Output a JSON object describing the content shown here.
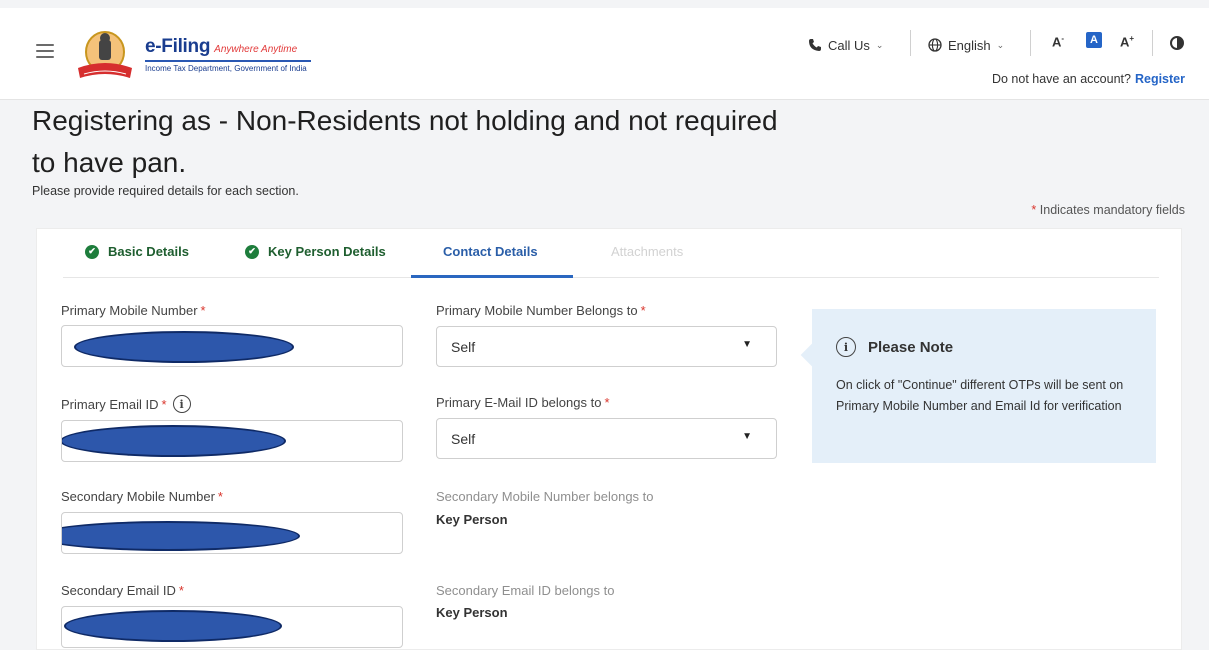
{
  "header": {
    "logo_brand": "e-Filing",
    "logo_tagline": "Anywhere Anytime",
    "logo_subtitle": "Income Tax Department, Government of India",
    "call_us": "Call Us",
    "language": "English",
    "font_decrease": "A",
    "font_normal": "A",
    "font_increase": "A",
    "account_prompt": "Do not have an account?",
    "register_link": "Register"
  },
  "page": {
    "title": "Registering as - Non-Residents not holding and not required to have pan.",
    "subtitle": "Please provide required details for each section.",
    "mandatory_star": "*",
    "mandatory_note": "Indicates mandatory fields"
  },
  "tabs": [
    {
      "label": "Basic Details",
      "state": "completed"
    },
    {
      "label": "Key Person Details",
      "state": "completed"
    },
    {
      "label": "Contact Details",
      "state": "active"
    },
    {
      "label": "Attachments",
      "state": "disabled"
    }
  ],
  "form": {
    "primary_mobile_label": "Primary Mobile Number",
    "primary_mobile_belongs_label": "Primary Mobile Number Belongs to",
    "primary_mobile_belongs_value": "Self",
    "primary_email_label": "Primary Email ID",
    "primary_email_belongs_label": "Primary E-Mail ID belongs to",
    "primary_email_belongs_value": "Self",
    "secondary_mobile_label": "Secondary Mobile Number",
    "secondary_mobile_belongs_label": "Secondary Mobile Number belongs to",
    "secondary_mobile_belongs_value": "Key Person",
    "secondary_email_label": "Secondary Email ID",
    "secondary_email_belongs_label": "Secondary Email ID belongs to",
    "secondary_email_belongs_value": "Key Person",
    "required_mark": "*"
  },
  "note": {
    "title": "Please Note",
    "body": "On click of \"Continue\" different OTPs will be sent on Primary Mobile Number and Email Id for verification"
  },
  "icons": {
    "call": "phone-icon",
    "language": "globe-icon",
    "check": "check-circle-icon",
    "info": "info-icon",
    "contrast": "contrast-icon",
    "menu": "hamburger-icon"
  },
  "colors": {
    "brand_blue": "#1a3d8f",
    "link_blue": "#2565c7",
    "success_green": "#1e7d3c",
    "required_red": "#d9342b",
    "note_bg": "#e4eff9"
  }
}
